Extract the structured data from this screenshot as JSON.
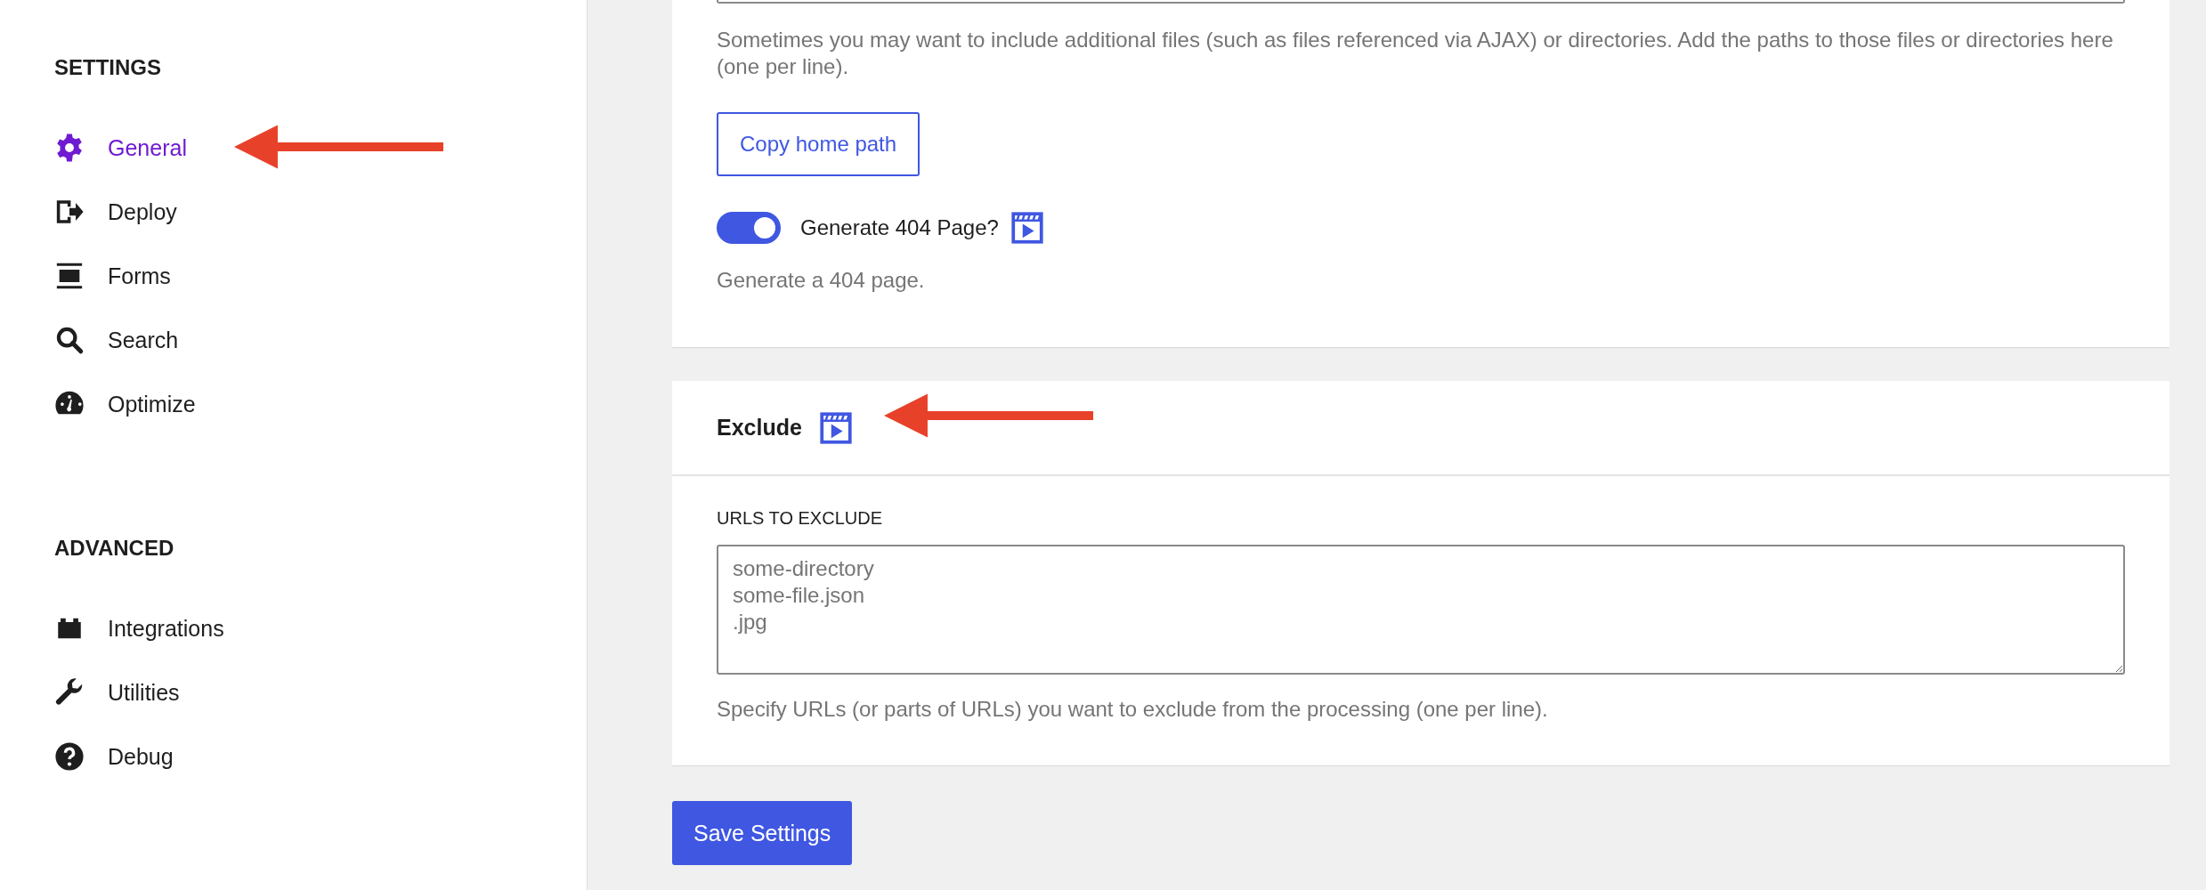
{
  "sidebar": {
    "sections": [
      {
        "title": "SETTINGS",
        "items": [
          {
            "label": "General",
            "kind": "gear",
            "selected": true
          },
          {
            "label": "Deploy",
            "kind": "exit",
            "selected": false
          },
          {
            "label": "Forms",
            "kind": "form",
            "selected": false
          },
          {
            "label": "Search",
            "kind": "search",
            "selected": false
          },
          {
            "label": "Optimize",
            "kind": "gauge",
            "selected": false
          }
        ]
      },
      {
        "title": "ADVANCED",
        "items": [
          {
            "label": "Integrations",
            "kind": "block",
            "selected": false
          },
          {
            "label": "Utilities",
            "kind": "wrench",
            "selected": false
          },
          {
            "label": "Debug",
            "kind": "help",
            "selected": false
          }
        ]
      }
    ]
  },
  "general_panel": {
    "files_help": "Sometimes you may want to include additional files (such as files referenced via AJAX) or directories. Add the paths to those files or directories here (one per line).",
    "copy_button": "Copy home path",
    "toggle": {
      "label": "Generate 404 Page?",
      "on": true
    },
    "toggle_help": "Generate a 404 page."
  },
  "exclude_panel": {
    "title": "Exclude",
    "field_label": "URLS TO EXCLUDE",
    "placeholder": "some-directory\nsome-file.json\n.jpg",
    "help": "Specify URLs (or parts of URLs) you want to exclude from the processing (one per line)."
  },
  "save_button": "Save Settings"
}
